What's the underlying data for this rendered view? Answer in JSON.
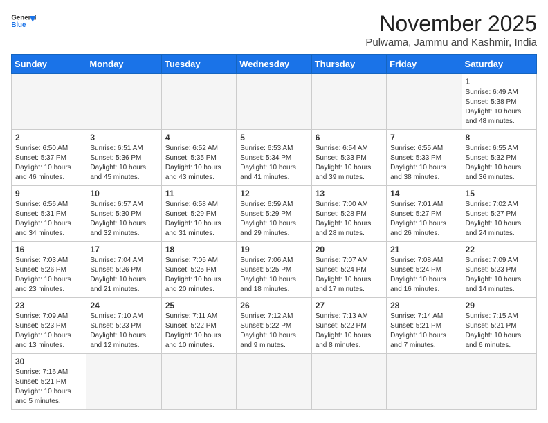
{
  "header": {
    "logo_line1": "General",
    "logo_line2": "Blue",
    "month": "November 2025",
    "location": "Pulwama, Jammu and Kashmir, India"
  },
  "weekdays": [
    "Sunday",
    "Monday",
    "Tuesday",
    "Wednesday",
    "Thursday",
    "Friday",
    "Saturday"
  ],
  "weeks": [
    [
      {
        "day": "",
        "info": ""
      },
      {
        "day": "",
        "info": ""
      },
      {
        "day": "",
        "info": ""
      },
      {
        "day": "",
        "info": ""
      },
      {
        "day": "",
        "info": ""
      },
      {
        "day": "",
        "info": ""
      },
      {
        "day": "1",
        "info": "Sunrise: 6:49 AM\nSunset: 5:38 PM\nDaylight: 10 hours\nand 48 minutes."
      }
    ],
    [
      {
        "day": "2",
        "info": "Sunrise: 6:50 AM\nSunset: 5:37 PM\nDaylight: 10 hours\nand 46 minutes."
      },
      {
        "day": "3",
        "info": "Sunrise: 6:51 AM\nSunset: 5:36 PM\nDaylight: 10 hours\nand 45 minutes."
      },
      {
        "day": "4",
        "info": "Sunrise: 6:52 AM\nSunset: 5:35 PM\nDaylight: 10 hours\nand 43 minutes."
      },
      {
        "day": "5",
        "info": "Sunrise: 6:53 AM\nSunset: 5:34 PM\nDaylight: 10 hours\nand 41 minutes."
      },
      {
        "day": "6",
        "info": "Sunrise: 6:54 AM\nSunset: 5:33 PM\nDaylight: 10 hours\nand 39 minutes."
      },
      {
        "day": "7",
        "info": "Sunrise: 6:55 AM\nSunset: 5:33 PM\nDaylight: 10 hours\nand 38 minutes."
      },
      {
        "day": "8",
        "info": "Sunrise: 6:55 AM\nSunset: 5:32 PM\nDaylight: 10 hours\nand 36 minutes."
      }
    ],
    [
      {
        "day": "9",
        "info": "Sunrise: 6:56 AM\nSunset: 5:31 PM\nDaylight: 10 hours\nand 34 minutes."
      },
      {
        "day": "10",
        "info": "Sunrise: 6:57 AM\nSunset: 5:30 PM\nDaylight: 10 hours\nand 32 minutes."
      },
      {
        "day": "11",
        "info": "Sunrise: 6:58 AM\nSunset: 5:29 PM\nDaylight: 10 hours\nand 31 minutes."
      },
      {
        "day": "12",
        "info": "Sunrise: 6:59 AM\nSunset: 5:29 PM\nDaylight: 10 hours\nand 29 minutes."
      },
      {
        "day": "13",
        "info": "Sunrise: 7:00 AM\nSunset: 5:28 PM\nDaylight: 10 hours\nand 28 minutes."
      },
      {
        "day": "14",
        "info": "Sunrise: 7:01 AM\nSunset: 5:27 PM\nDaylight: 10 hours\nand 26 minutes."
      },
      {
        "day": "15",
        "info": "Sunrise: 7:02 AM\nSunset: 5:27 PM\nDaylight: 10 hours\nand 24 minutes."
      }
    ],
    [
      {
        "day": "16",
        "info": "Sunrise: 7:03 AM\nSunset: 5:26 PM\nDaylight: 10 hours\nand 23 minutes."
      },
      {
        "day": "17",
        "info": "Sunrise: 7:04 AM\nSunset: 5:26 PM\nDaylight: 10 hours\nand 21 minutes."
      },
      {
        "day": "18",
        "info": "Sunrise: 7:05 AM\nSunset: 5:25 PM\nDaylight: 10 hours\nand 20 minutes."
      },
      {
        "day": "19",
        "info": "Sunrise: 7:06 AM\nSunset: 5:25 PM\nDaylight: 10 hours\nand 18 minutes."
      },
      {
        "day": "20",
        "info": "Sunrise: 7:07 AM\nSunset: 5:24 PM\nDaylight: 10 hours\nand 17 minutes."
      },
      {
        "day": "21",
        "info": "Sunrise: 7:08 AM\nSunset: 5:24 PM\nDaylight: 10 hours\nand 16 minutes."
      },
      {
        "day": "22",
        "info": "Sunrise: 7:09 AM\nSunset: 5:23 PM\nDaylight: 10 hours\nand 14 minutes."
      }
    ],
    [
      {
        "day": "23",
        "info": "Sunrise: 7:09 AM\nSunset: 5:23 PM\nDaylight: 10 hours\nand 13 minutes."
      },
      {
        "day": "24",
        "info": "Sunrise: 7:10 AM\nSunset: 5:23 PM\nDaylight: 10 hours\nand 12 minutes."
      },
      {
        "day": "25",
        "info": "Sunrise: 7:11 AM\nSunset: 5:22 PM\nDaylight: 10 hours\nand 10 minutes."
      },
      {
        "day": "26",
        "info": "Sunrise: 7:12 AM\nSunset: 5:22 PM\nDaylight: 10 hours\nand 9 minutes."
      },
      {
        "day": "27",
        "info": "Sunrise: 7:13 AM\nSunset: 5:22 PM\nDaylight: 10 hours\nand 8 minutes."
      },
      {
        "day": "28",
        "info": "Sunrise: 7:14 AM\nSunset: 5:21 PM\nDaylight: 10 hours\nand 7 minutes."
      },
      {
        "day": "29",
        "info": "Sunrise: 7:15 AM\nSunset: 5:21 PM\nDaylight: 10 hours\nand 6 minutes."
      }
    ],
    [
      {
        "day": "30",
        "info": "Sunrise: 7:16 AM\nSunset: 5:21 PM\nDaylight: 10 hours\nand 5 minutes."
      },
      {
        "day": "",
        "info": ""
      },
      {
        "day": "",
        "info": ""
      },
      {
        "day": "",
        "info": ""
      },
      {
        "day": "",
        "info": ""
      },
      {
        "day": "",
        "info": ""
      },
      {
        "day": "",
        "info": ""
      }
    ]
  ]
}
